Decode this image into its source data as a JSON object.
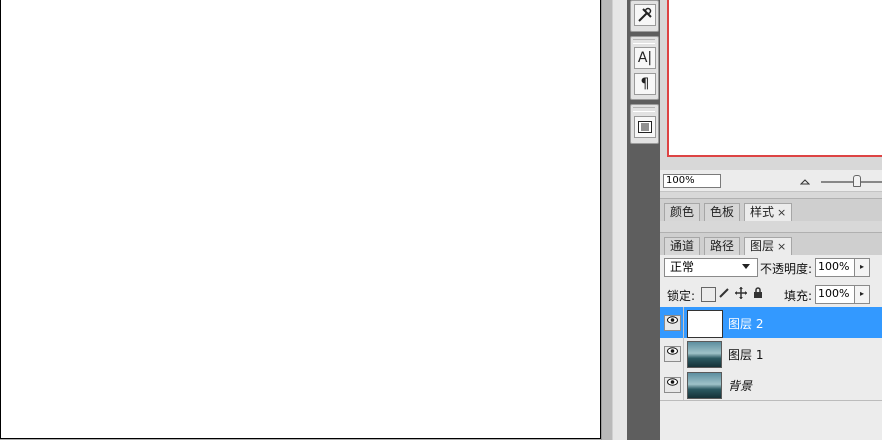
{
  "toolbar_icons": [
    "tools-icon",
    "character-icon",
    "paragraph-icon",
    "clone-source-icon"
  ],
  "navigator": {
    "zoom_value": "100%"
  },
  "style_tabs": [
    {
      "label": "颜色",
      "active": false
    },
    {
      "label": "色板",
      "active": false
    },
    {
      "label": "样式",
      "active": true,
      "close": "×"
    }
  ],
  "layer_tabs": [
    {
      "label": "通道",
      "active": false
    },
    {
      "label": "路径",
      "active": false
    },
    {
      "label": "图层",
      "active": true,
      "close": "×"
    }
  ],
  "layers_panel": {
    "blend_mode": "正常",
    "opacity_label": "不透明度:",
    "opacity_value": "100%",
    "lock_label": "锁定:",
    "fill_label": "填充:",
    "fill_value": "100%",
    "spin_arrow": "▸"
  },
  "layers": [
    {
      "name": "图层 2",
      "selected": true,
      "thumbnail": "white"
    },
    {
      "name": "图层 1",
      "selected": false,
      "thumbnail": "scene"
    },
    {
      "name": "背景",
      "selected": false,
      "thumbnail": "scene"
    }
  ],
  "colors": {
    "selected_layer": "#3399ff",
    "navigator_frame": "#dd4444",
    "dock_background": "#5e5e5e"
  }
}
